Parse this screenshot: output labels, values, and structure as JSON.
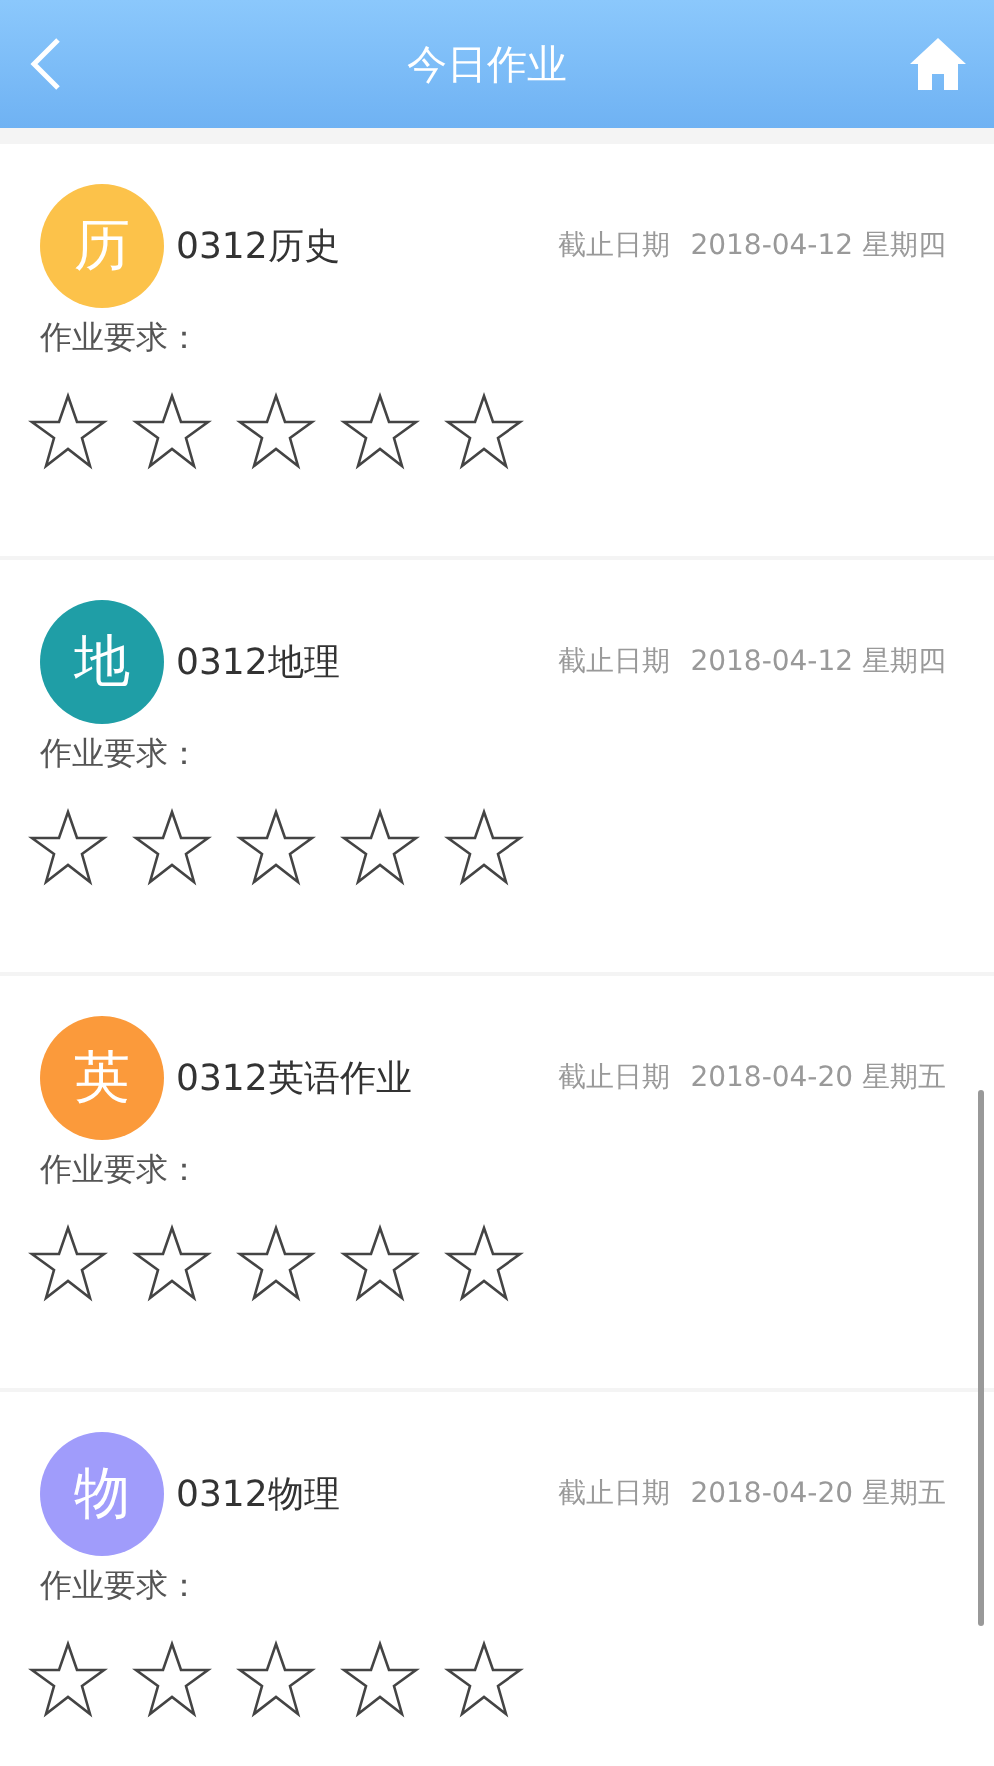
{
  "header": {
    "title": "今日作业"
  },
  "assignments": [
    {
      "avatar": "历",
      "color": "#fcc24a",
      "title": "0312历史",
      "deadline_label": "截止日期",
      "deadline": "2018-04-12 星期四",
      "requirement_label": "作业要求：",
      "stars": 0
    },
    {
      "avatar": "地",
      "color": "#1f9ea6",
      "title": "0312地理",
      "deadline_label": "截止日期",
      "deadline": "2018-04-12 星期四",
      "requirement_label": "作业要求：",
      "stars": 0
    },
    {
      "avatar": "英",
      "color": "#fb9a3b",
      "title": "0312英语作业",
      "deadline_label": "截止日期",
      "deadline": "2018-04-20 星期五",
      "requirement_label": "作业要求：",
      "stars": 0
    },
    {
      "avatar": "物",
      "color": "#a09cfb",
      "title": "0312物理",
      "deadline_label": "截止日期",
      "deadline": "2018-04-20 星期五",
      "requirement_label": "作业要求：",
      "stars": 0
    }
  ]
}
